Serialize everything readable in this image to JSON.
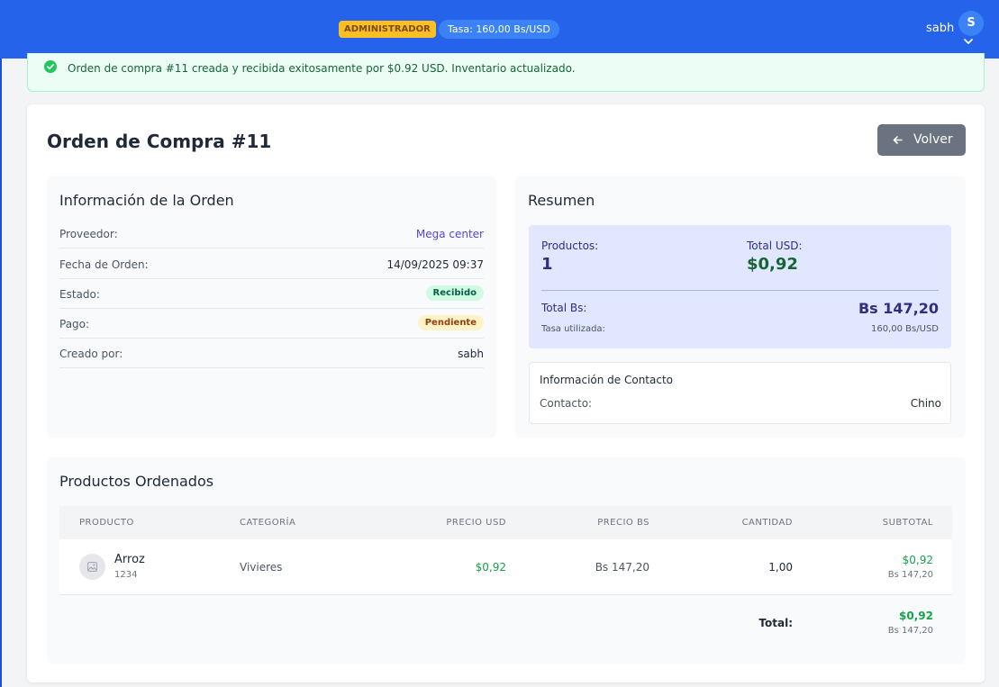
{
  "header": {
    "role_badge": "ADMINISTRADOR",
    "rate_badge": "Tasa: 160,00 Bs/USD",
    "user_name": "sabh",
    "avatar_initial": "S"
  },
  "alert": {
    "message": "Orden de compra #11 creada y recibida exitosamente por $0.92 USD. Inventario actualizado."
  },
  "page": {
    "title": "Orden de Compra #11",
    "back_button": "Volver"
  },
  "order_info": {
    "title": "Información de la Orden",
    "rows": [
      {
        "label": "Proveedor:",
        "value": "Mega center"
      },
      {
        "label": "Fecha de Orden:",
        "value": "14/09/2025 09:37"
      },
      {
        "label": "Estado:",
        "value": "Recibido"
      },
      {
        "label": "Pago:",
        "value": "Pendiente"
      },
      {
        "label": "Creado por:",
        "value": "sabh"
      }
    ]
  },
  "summary": {
    "title": "Resumen",
    "products_label": "Productos:",
    "products_value": "1",
    "total_usd_label": "Total USD:",
    "total_usd_value": "$0,92",
    "total_bs_label": "Total Bs:",
    "total_bs_value": "Bs 147,20",
    "rate_label": "Tasa utilizada:",
    "rate_value": "160,00 Bs/USD",
    "contact_title": "Información de Contacto",
    "contact_label": "Contacto:",
    "contact_value": "Chino"
  },
  "products": {
    "title": "Productos Ordenados",
    "columns": [
      "PRODUCTO",
      "CATEGORÍA",
      "PRECIO USD",
      "PRECIO BS",
      "CANTIDAD",
      "SUBTOTAL"
    ],
    "rows": [
      {
        "name": "Arroz",
        "code": "1234",
        "category": "Vivieres",
        "price_usd": "$0,92",
        "price_bs": "Bs 147,20",
        "quantity": "1,00",
        "subtotal_usd": "$0,92",
        "subtotal_bs": "Bs 147,20"
      }
    ],
    "total_label": "Total:",
    "total_usd": "$0,92",
    "total_bs": "Bs 147,20"
  },
  "colors": {
    "topbar": "#2563eb",
    "success": "#16a34a",
    "link": "#4f46e5",
    "summary_bg": "#e0e7ff"
  }
}
